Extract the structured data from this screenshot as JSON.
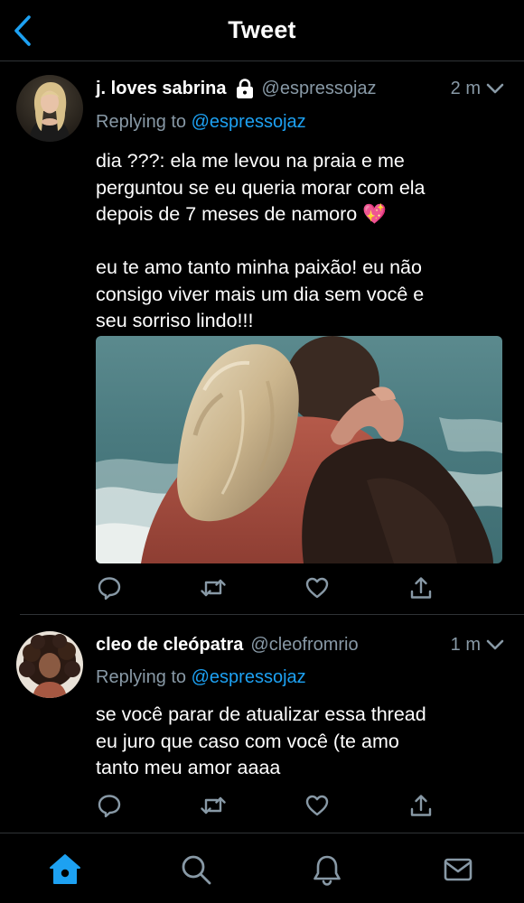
{
  "header": {
    "title": "Tweet",
    "back_icon": "chevron-left-icon"
  },
  "colors": {
    "accent": "#1da1f2",
    "secondary_text": "#8899a6",
    "background": "#000000",
    "divider": "#2f3336"
  },
  "tweets": [
    {
      "name": "j. loves sabrina",
      "protected": true,
      "handle": "@espressojaz",
      "time": "2 m",
      "replying_prefix": "Replying to ",
      "replying_to": "@espressojaz",
      "lines": [
        "dia ???: ela me levou na praia e me",
        "perguntou se eu queria morar com ela",
        "depois de 7 meses de namoro 💖",
        "",
        "eu te amo tanto minha paixão! eu não",
        "consigo viver mais um dia sem você e",
        "seu sorriso lindo!!!"
      ],
      "has_photo": true
    },
    {
      "name": "cleo de cleópatra",
      "protected": false,
      "handle": "@cleofromrio",
      "time": "1 m",
      "replying_prefix": "Replying to ",
      "replying_to": "@espressojaz",
      "lines": [
        "se você parar de atualizar essa thread",
        "eu juro que caso com você (te amo",
        "tanto meu amor aaaa"
      ],
      "has_photo": false
    }
  ],
  "actions": [
    "reply-icon",
    "retweet-icon",
    "like-icon",
    "share-icon"
  ],
  "tabbar": {
    "items": [
      "home-icon",
      "search-icon",
      "notifications-icon",
      "messages-icon"
    ],
    "active": "home-icon"
  }
}
